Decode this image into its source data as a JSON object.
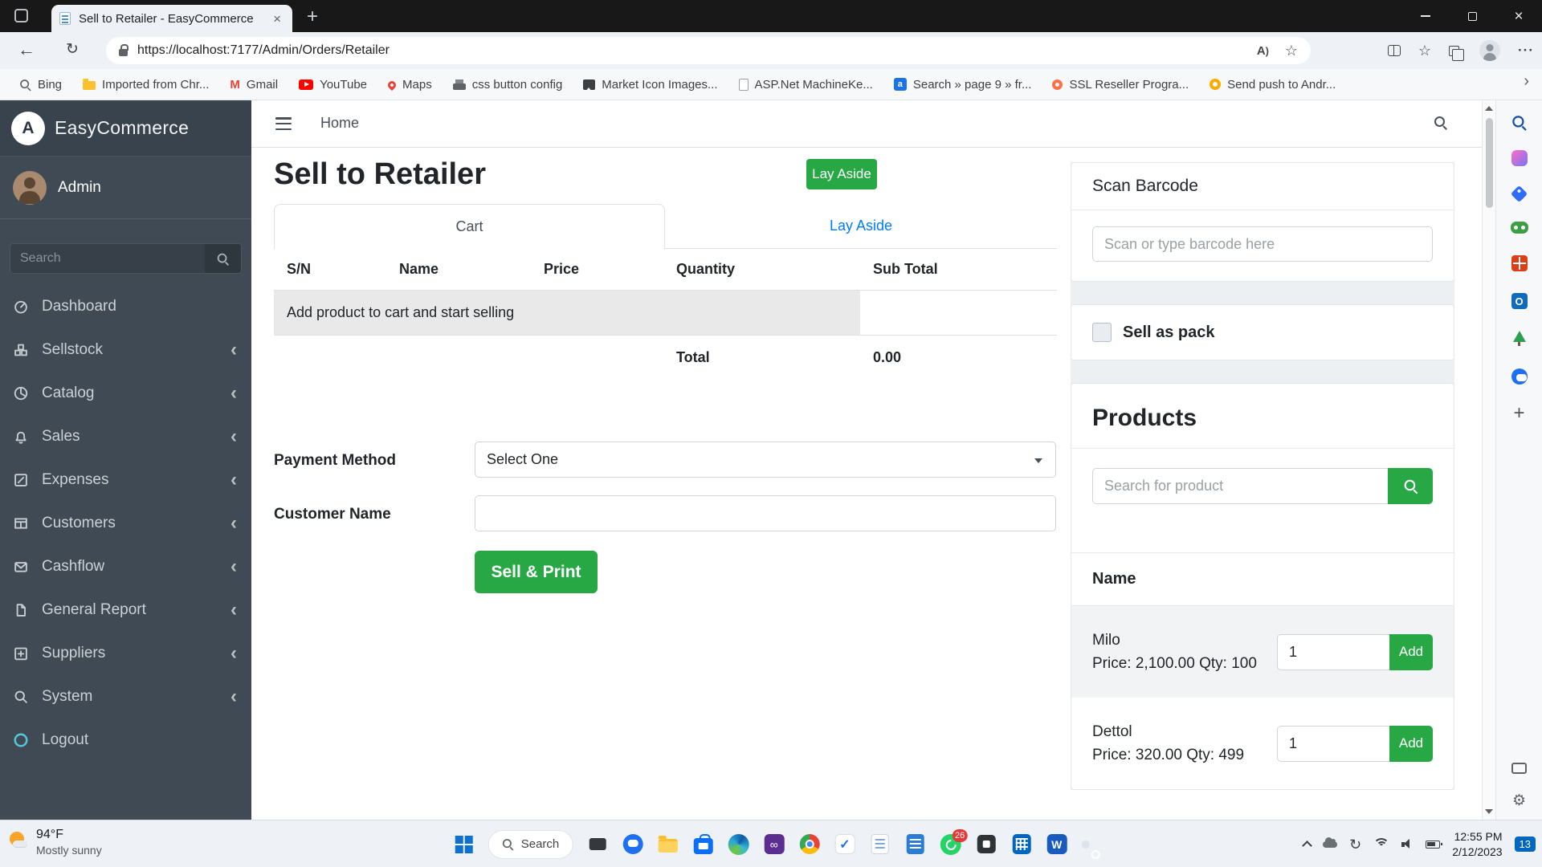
{
  "colors": {
    "accent_green": "#28a745",
    "link_blue": "#007bff",
    "sidebar_bg": "#3f4a54",
    "taskbar_badge_blue": "#0067c0"
  },
  "browser": {
    "tab_title": "Sell to Retailer - EasyCommerce",
    "url": "https://localhost:7177/Admin/Orders/Retailer",
    "bookmarks": [
      "Bing",
      "Imported from Chr...",
      "Gmail",
      "YouTube",
      "Maps",
      "css button config",
      "Market Icon Images...",
      "ASP.Net MachineKe...",
      "Search » page 9 » fr...",
      "SSL Reseller Progra...",
      "Send push to Andr..."
    ]
  },
  "app": {
    "sidebar": {
      "brand": "EasyCommerce",
      "brand_letter": "A",
      "user": "Admin",
      "search_placeholder": "Search",
      "items": [
        {
          "label": "Dashboard"
        },
        {
          "label": "Sellstock"
        },
        {
          "label": "Catalog"
        },
        {
          "label": "Sales"
        },
        {
          "label": "Expenses"
        },
        {
          "label": "Customers"
        },
        {
          "label": "Cashflow"
        },
        {
          "label": "General Report"
        },
        {
          "label": "Suppliers"
        },
        {
          "label": "System"
        },
        {
          "label": "Logout"
        }
      ]
    },
    "navbar": {
      "home": "Home"
    },
    "page": {
      "title": "Sell to Retailer",
      "lay_aside_button": "Lay Aside",
      "tab_cart": "Cart",
      "tab_lay_aside": "Lay Aside",
      "table_headers": [
        "S/N",
        "Name",
        "Price",
        "Quantity",
        "Sub Total"
      ],
      "empty_cart_message": "Add product to cart and start selling",
      "total_label": "Total",
      "total_value": "0.00",
      "payment_method_label": "Payment Method",
      "payment_method_value": "Select One",
      "customer_name_label": "Customer Name",
      "sell_print_button": "Sell & Print"
    },
    "right_panel": {
      "scan_barcode_title": "Scan Barcode",
      "scan_barcode_placeholder": "Scan or type barcode here",
      "sell_as_pack_label": "Sell as pack",
      "products_title": "Products",
      "product_search_placeholder": "Search for product",
      "name_header": "Name",
      "products": [
        {
          "name": "Milo",
          "details": "Price: 2,100.00 Qty: 100",
          "qty": "1",
          "add_label": "Add"
        },
        {
          "name": "Dettol",
          "details": "Price: 320.00 Qty: 499",
          "qty": "1",
          "add_label": "Add"
        }
      ]
    }
  },
  "taskbar": {
    "weather_temp": "94°F",
    "weather_desc": "Mostly sunny",
    "search_label": "Search",
    "whatsapp_badge": "26",
    "time": "12:55 PM",
    "date": "2/12/2023",
    "notification_count": "13"
  }
}
